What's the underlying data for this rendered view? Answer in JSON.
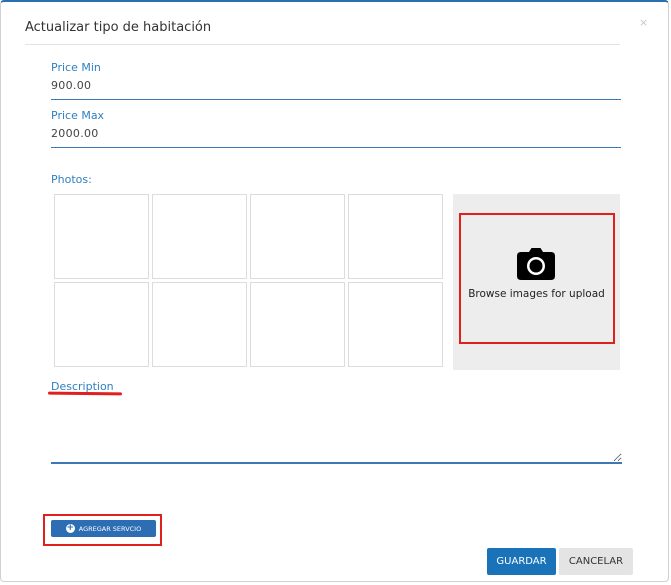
{
  "modal": {
    "title": "Actualizar tipo de habitación",
    "close_symbol": "×"
  },
  "fields": {
    "price_min": {
      "label": "Price Min",
      "value": "900.00"
    },
    "price_max": {
      "label": "Price Max",
      "value": "2000.00"
    }
  },
  "photos": {
    "label": "Photos:",
    "upload_text": "Browse images for upload",
    "upload_icon": "camera-icon"
  },
  "description": {
    "label": "Description",
    "value": ""
  },
  "buttons": {
    "add_service_label": "AGREGAR SERVCIO",
    "add_service_icon": "plus-circle-icon",
    "save_label": "GUARDAR",
    "cancel_label": "CANCELAR"
  },
  "colors": {
    "accent": "#1a73b8",
    "label_blue": "#2f7fc0",
    "highlight_red": "#e0201c"
  }
}
